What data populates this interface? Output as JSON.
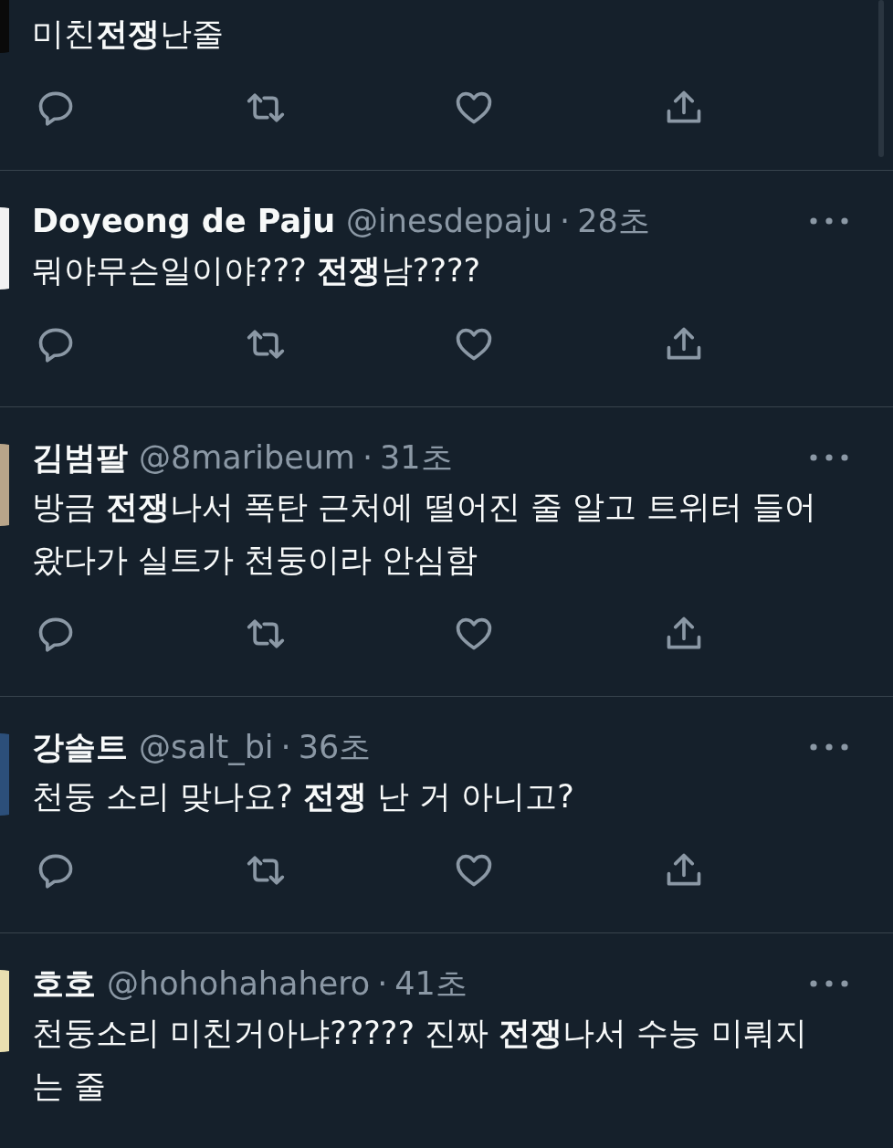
{
  "tweets": [
    {
      "color": "#0a0a0a",
      "text": "미친**전쟁**난줄",
      "show_actions": true
    },
    {
      "name": "Doyeong de Paju",
      "handle": "@inesdepaju",
      "time": "28초",
      "color": "#f2f2f2",
      "text": "뭐야무슨일이야??? **전쟁**남????",
      "show_actions": true
    },
    {
      "name": "김범팔",
      "handle": "@8maribeum",
      "time": "31초",
      "color": "#b9a58a",
      "text": "방금 **전쟁**나서 폭탄 근처에 떨어진 줄 알고 트위터 들어왔다가 실트가 천둥이라 안심함",
      "show_actions": true
    },
    {
      "name": "강솔트",
      "handle": "@salt_bi",
      "time": "36초",
      "color": "#2c4f7a",
      "text": "천둥 소리 맞나요? **전쟁** 난 거 아니고?",
      "show_actions": true
    },
    {
      "name": "호호",
      "handle": "@hohohahahero",
      "time": "41초",
      "color": "#e9dfb0",
      "text": "천둥소리 미친거아냐????? 진짜 **전쟁**나서 수능 미뤄지는 줄",
      "show_actions": false
    }
  ],
  "separator": "·"
}
